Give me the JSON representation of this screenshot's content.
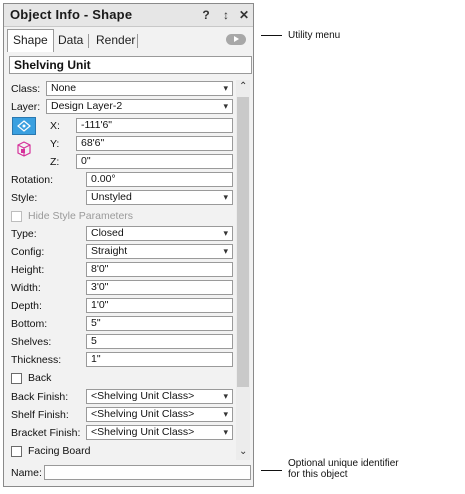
{
  "palette": {
    "title": "Object Info - Shape",
    "tabs": [
      {
        "label": "Shape",
        "active": true
      },
      {
        "label": "Data",
        "active": false
      },
      {
        "label": "Render",
        "active": false
      }
    ],
    "object_type": "Shelving Unit",
    "class": {
      "label": "Class:",
      "value": "None"
    },
    "layer": {
      "label": "Layer:",
      "value": "Design Layer-2"
    },
    "x": {
      "label": "X:",
      "value": "-111'6\""
    },
    "y": {
      "label": "Y:",
      "value": "68'6\""
    },
    "z": {
      "label": "Z:",
      "value": "0\""
    },
    "rotation": {
      "label": "Rotation:",
      "value": "0.00°"
    },
    "style": {
      "label": "Style:",
      "value": "Unstyled"
    },
    "hide_style": {
      "label": "Hide Style Parameters",
      "checked": false,
      "enabled": false
    },
    "type": {
      "label": "Type:",
      "value": "Closed"
    },
    "config": {
      "label": "Config:",
      "value": "Straight"
    },
    "height": {
      "label": "Height:",
      "value": "8'0\""
    },
    "width": {
      "label": "Width:",
      "value": "3'0\""
    },
    "depth": {
      "label": "Depth:",
      "value": "1'0\""
    },
    "bottom": {
      "label": "Bottom:",
      "value": "5\""
    },
    "shelves": {
      "label": "Shelves:",
      "value": "5"
    },
    "thickness": {
      "label": "Thickness:",
      "value": "1\""
    },
    "back": {
      "label": "Back",
      "checked": false
    },
    "back_finish": {
      "label": "Back Finish:",
      "value": "<Shelving Unit Class>"
    },
    "shelf_finish": {
      "label": "Shelf Finish:",
      "value": "<Shelving Unit Class>"
    },
    "bracket_finish": {
      "label": "Bracket Finish:",
      "value": "<Shelving Unit Class>"
    },
    "facing_board": {
      "label": "Facing Board",
      "checked": false
    },
    "name": {
      "label": "Name:",
      "value": ""
    }
  },
  "callouts": {
    "utility_menu": "Utility menu",
    "name_line1": "Optional unique identifier",
    "name_line2": "for this object"
  },
  "colors": {
    "panel": "#f2f2f2",
    "titlebar": "#e6e6e6",
    "field_border": "#9a9a9a"
  }
}
